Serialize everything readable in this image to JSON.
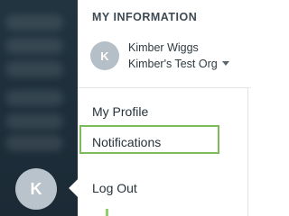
{
  "sidebar": {
    "avatar_initial": "K"
  },
  "menu": {
    "heading": "MY INFORMATION",
    "user": {
      "initial": "K",
      "name": "Kimber Wiggs",
      "org": "Kimber's Test Org"
    },
    "items": [
      {
        "label": "My Profile"
      },
      {
        "label": "Notifications"
      },
      {
        "label": "Log Out"
      }
    ],
    "highlight_color": "#7dbb5a"
  }
}
